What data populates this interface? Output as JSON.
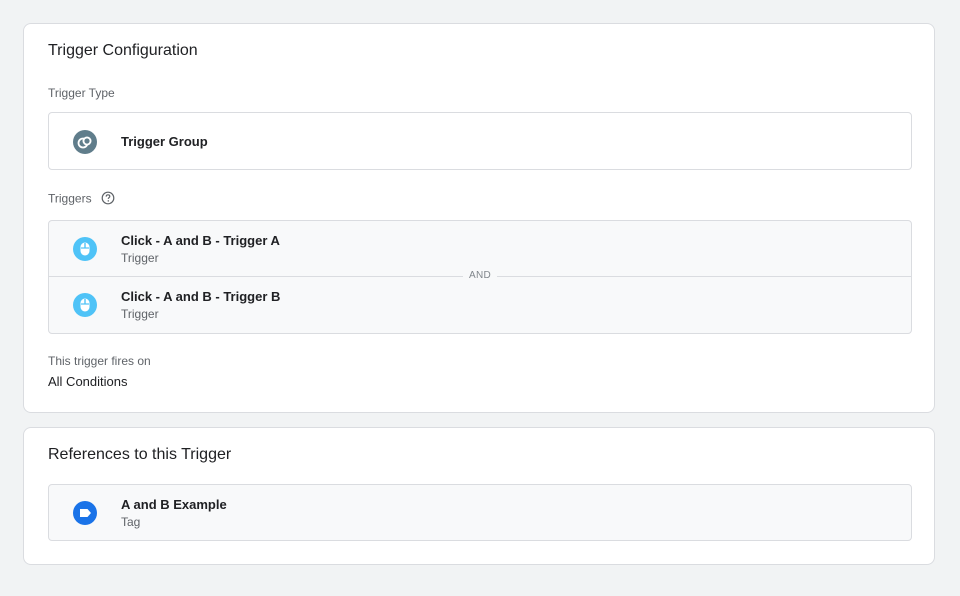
{
  "config": {
    "title": "Trigger Configuration",
    "trigger_type_label": "Trigger Type",
    "trigger_type": {
      "name": "Trigger Group",
      "icon": "trigger-group-icon"
    },
    "triggers_label": "Triggers",
    "triggers": [
      {
        "name": "Click - A and B - Trigger A",
        "type": "Trigger",
        "icon": "mouse-icon"
      },
      {
        "name": "Click - A and B - Trigger B",
        "type": "Trigger",
        "icon": "mouse-icon"
      }
    ],
    "and_label": "AND",
    "fires_label": "This trigger fires on",
    "fires_value": "All Conditions"
  },
  "references": {
    "title": "References to this Trigger",
    "items": [
      {
        "name": "A and B Example",
        "type": "Tag",
        "icon": "tag-icon"
      }
    ]
  },
  "colors": {
    "background": "#f1f3f4",
    "group_icon": "#607d8b",
    "mouse_icon": "#4fc3f7",
    "tag_icon": "#1a73e8"
  }
}
